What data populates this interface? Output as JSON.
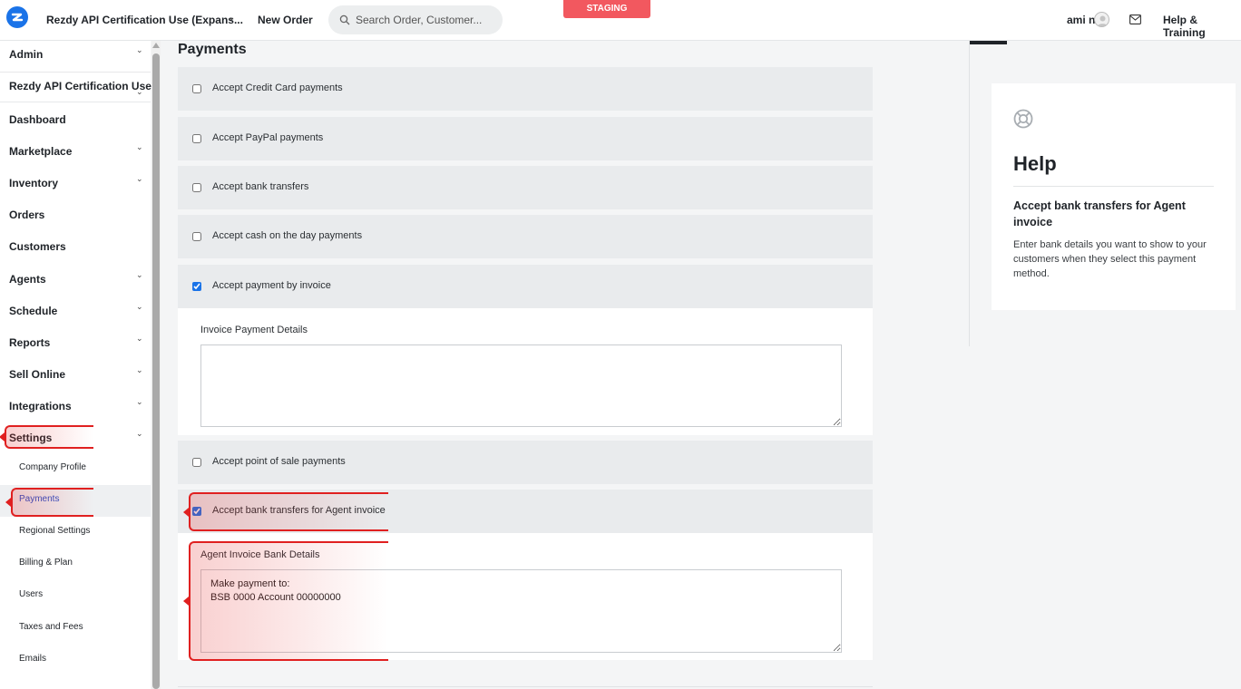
{
  "topbar": {
    "account_name": "Rezdy API Certification Use (Expans...",
    "new_order": "New Order",
    "search_placeholder": "Search Order, Customer...",
    "env_badge": "STAGING",
    "user_name": "ami n",
    "help_training": "Help & Training"
  },
  "sidebar": {
    "items": [
      {
        "label": "Admin",
        "chevron": true
      },
      {
        "label": "Rezdy API Certification Use",
        "chevron": true
      },
      {
        "label": "Dashboard",
        "chevron": false
      },
      {
        "label": "Marketplace",
        "chevron": true
      },
      {
        "label": "Inventory",
        "chevron": true
      },
      {
        "label": "Orders",
        "chevron": false
      },
      {
        "label": "Customers",
        "chevron": false
      },
      {
        "label": "Agents",
        "chevron": true
      },
      {
        "label": "Schedule",
        "chevron": true
      },
      {
        "label": "Reports",
        "chevron": true
      },
      {
        "label": "Sell Online",
        "chevron": true
      },
      {
        "label": "Integrations",
        "chevron": true
      },
      {
        "label": "Settings",
        "chevron": true
      }
    ],
    "settings_subitems": [
      {
        "label": "Company Profile",
        "active": false
      },
      {
        "label": "Payments",
        "active": true
      },
      {
        "label": "Regional Settings",
        "active": false
      },
      {
        "label": "Billing & Plan",
        "active": false
      },
      {
        "label": "Users",
        "active": false
      },
      {
        "label": "Taxes and Fees",
        "active": false
      },
      {
        "label": "Emails",
        "active": false
      }
    ]
  },
  "main": {
    "title": "Payments",
    "options": [
      {
        "label": "Accept Credit Card payments",
        "checked": false
      },
      {
        "label": "Accept PayPal payments",
        "checked": false
      },
      {
        "label": "Accept bank transfers",
        "checked": false
      },
      {
        "label": "Accept cash on the day payments",
        "checked": false
      },
      {
        "label": "Accept payment by invoice",
        "checked": true
      },
      {
        "label": "Accept point of sale payments",
        "checked": false
      },
      {
        "label": "Accept bank transfers for Agent invoice",
        "checked": true
      }
    ],
    "invoice_details": {
      "label": "Invoice Payment Details",
      "value": ""
    },
    "agent_details": {
      "label": "Agent Invoice Bank Details",
      "value": "Make payment to:\nBSB 0000 Account 00000000"
    }
  },
  "help": {
    "title": "Help",
    "subtitle": "Accept bank transfers for Agent invoice",
    "body": "Enter bank details you want to show to your customers when they select this payment method."
  },
  "colors": {
    "accent": "#1a73e8",
    "staging": "#f2585f",
    "highlight": "#e02020",
    "active_link": "#2a4ec7"
  }
}
